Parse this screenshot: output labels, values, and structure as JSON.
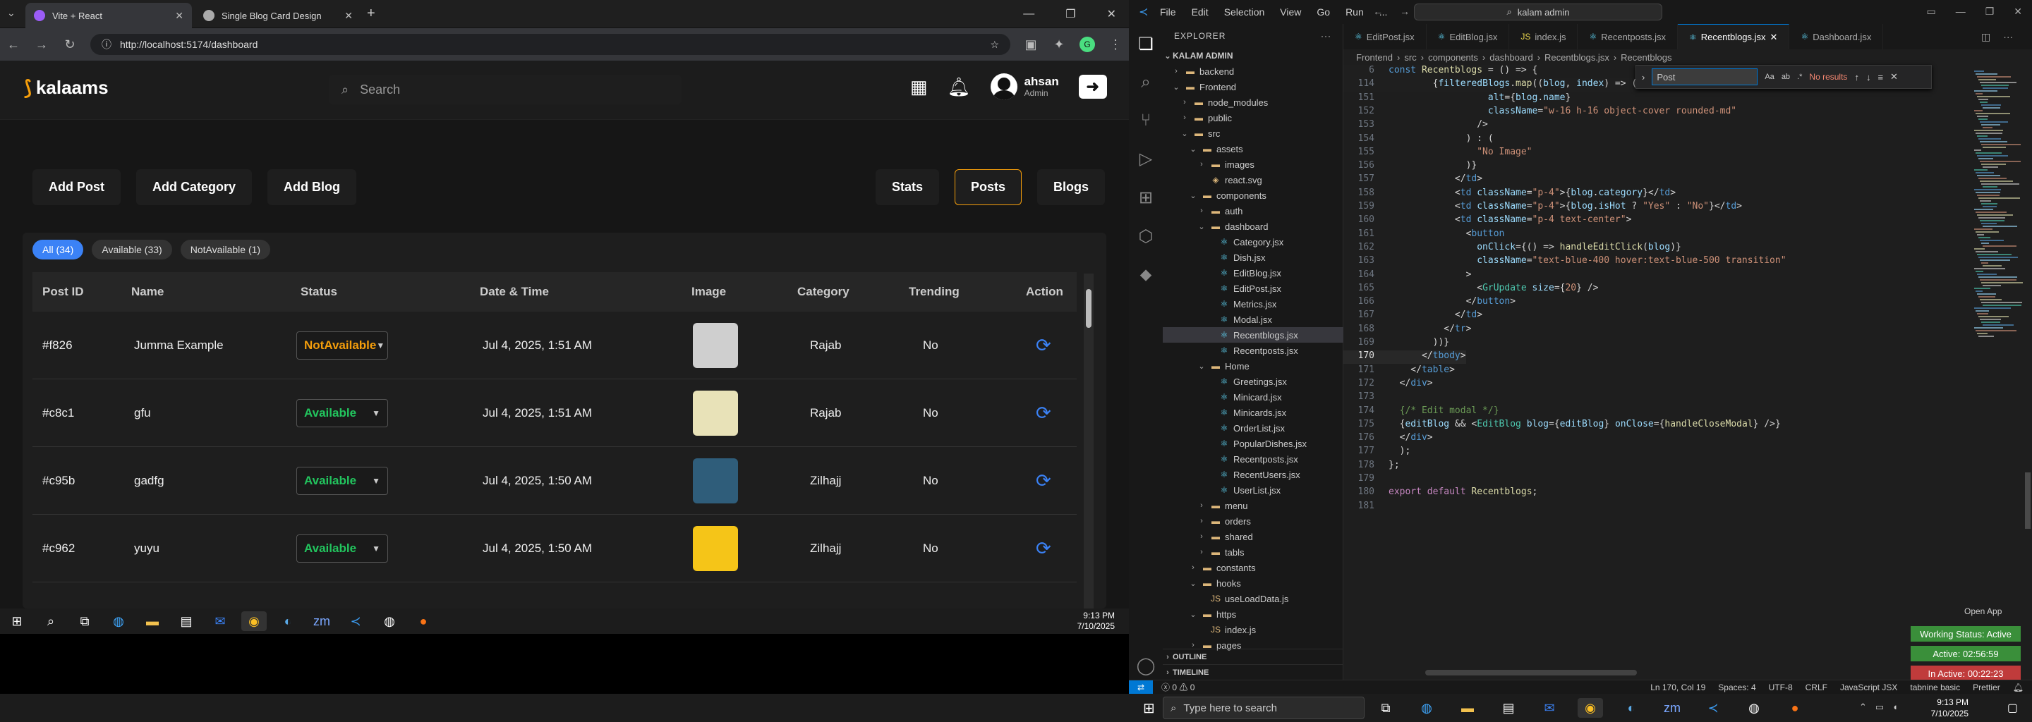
{
  "browser": {
    "tabs": [
      {
        "title": "Vite + React",
        "color": "#9b5cf6"
      },
      {
        "title": "Single Blog Card Design",
        "color": "#aaaaaa"
      }
    ],
    "url": "http://localhost:5174/dashboard"
  },
  "app": {
    "logo": "kalaams",
    "search_placeholder": "Search",
    "user_name": "ahsan",
    "user_role": "Admin",
    "actions_left": [
      "Add Post",
      "Add Category",
      "Add Blog"
    ],
    "actions_right": [
      "Stats",
      "Posts",
      "Blogs"
    ],
    "filters": [
      "All (34)",
      "Available (33)",
      "NotAvailable (1)"
    ],
    "columns": [
      "Post ID",
      "Name",
      "Status",
      "Date & Time",
      "Image",
      "Category",
      "Trending",
      "Action"
    ],
    "rows": [
      {
        "id": "#f826",
        "name": "Jumma Example",
        "status": "NotAvailable",
        "status_color": "#f59e0b",
        "date": "Jul 4, 2025, 1:51 AM",
        "thumb": "#cfcfcf",
        "category": "Rajab",
        "trending": "No"
      },
      {
        "id": "#c8c1",
        "name": "gfu",
        "status": "Available",
        "status_color": "#22c55e",
        "date": "Jul 4, 2025, 1:51 AM",
        "thumb": "#e8e2b8",
        "category": "Rajab",
        "trending": "No"
      },
      {
        "id": "#c95b",
        "name": "gadfg",
        "status": "Available",
        "status_color": "#22c55e",
        "date": "Jul 4, 2025, 1:50 AM",
        "thumb": "#2f5d7a",
        "category": "Zilhajj",
        "trending": "No"
      },
      {
        "id": "#c962",
        "name": "yuyu",
        "status": "Available",
        "status_color": "#22c55e",
        "date": "Jul 4, 2025, 1:50 AM",
        "thumb": "#f5c518",
        "category": "Zilhajj",
        "trending": "No"
      }
    ]
  },
  "taskbar_left": {
    "time": "9:13 PM",
    "date": "7/10/2025"
  },
  "vscode": {
    "menu": [
      "File",
      "Edit",
      "Selection",
      "View",
      "Go",
      "Run",
      "..."
    ],
    "search": "kalam admin",
    "explorer_title": "EXPLORER",
    "root": "KALAM ADMIN",
    "tree": [
      {
        "label": "backend",
        "indent": 1,
        "type": "folder",
        "open": false
      },
      {
        "label": "Frontend",
        "indent": 1,
        "type": "folder",
        "open": true
      },
      {
        "label": "node_modules",
        "indent": 2,
        "type": "folder",
        "open": false
      },
      {
        "label": "public",
        "indent": 2,
        "type": "folder",
        "open": false
      },
      {
        "label": "src",
        "indent": 2,
        "type": "folder",
        "open": true
      },
      {
        "label": "assets",
        "indent": 3,
        "type": "folder",
        "open": true
      },
      {
        "label": "images",
        "indent": 4,
        "type": "folder",
        "open": false
      },
      {
        "label": "react.svg",
        "indent": 4,
        "type": "file"
      },
      {
        "label": "components",
        "indent": 3,
        "type": "folder",
        "open": true
      },
      {
        "label": "auth",
        "indent": 4,
        "type": "folder",
        "open": false
      },
      {
        "label": "dashboard",
        "indent": 4,
        "type": "folder",
        "open": true
      },
      {
        "label": "Category.jsx",
        "indent": 5,
        "type": "file"
      },
      {
        "label": "Dish.jsx",
        "indent": 5,
        "type": "file"
      },
      {
        "label": "EditBlog.jsx",
        "indent": 5,
        "type": "file"
      },
      {
        "label": "EditPost.jsx",
        "indent": 5,
        "type": "file"
      },
      {
        "label": "Metrics.jsx",
        "indent": 5,
        "type": "file"
      },
      {
        "label": "Modal.jsx",
        "indent": 5,
        "type": "file"
      },
      {
        "label": "Recentblogs.jsx",
        "indent": 5,
        "type": "file",
        "selected": true
      },
      {
        "label": "Recentposts.jsx",
        "indent": 5,
        "type": "file"
      },
      {
        "label": "Home",
        "indent": 4,
        "type": "folder",
        "open": true
      },
      {
        "label": "Greetings.jsx",
        "indent": 5,
        "type": "file"
      },
      {
        "label": "Minicard.jsx",
        "indent": 5,
        "type": "file"
      },
      {
        "label": "Minicards.jsx",
        "indent": 5,
        "type": "file"
      },
      {
        "label": "OrderList.jsx",
        "indent": 5,
        "type": "file"
      },
      {
        "label": "PopularDishes.jsx",
        "indent": 5,
        "type": "file"
      },
      {
        "label": "Recentposts.jsx",
        "indent": 5,
        "type": "file"
      },
      {
        "label": "RecentUsers.jsx",
        "indent": 5,
        "type": "file"
      },
      {
        "label": "UserList.jsx",
        "indent": 5,
        "type": "file"
      },
      {
        "label": "menu",
        "indent": 4,
        "type": "folder",
        "open": false
      },
      {
        "label": "orders",
        "indent": 4,
        "type": "folder",
        "open": false
      },
      {
        "label": "shared",
        "indent": 4,
        "type": "folder",
        "open": false
      },
      {
        "label": "tabls",
        "indent": 4,
        "type": "folder",
        "open": false
      },
      {
        "label": "constants",
        "indent": 3,
        "type": "folder",
        "open": false
      },
      {
        "label": "hooks",
        "indent": 3,
        "type": "folder",
        "open": true
      },
      {
        "label": "useLoadData.js",
        "indent": 4,
        "type": "file"
      },
      {
        "label": "https",
        "indent": 3,
        "type": "folder",
        "open": true
      },
      {
        "label": "index.js",
        "indent": 4,
        "type": "file"
      },
      {
        "label": "pages",
        "indent": 3,
        "type": "folder",
        "open": false
      }
    ],
    "outline": "OUTLINE",
    "timeline": "TIMELINE",
    "tabs": [
      "EditPost.jsx",
      "EditBlog.jsx",
      "index.js",
      "Recentposts.jsx",
      "Recentblogs.jsx",
      "Dashboard.jsx"
    ],
    "active_tab": "Recentblogs.jsx",
    "breadcrumbs": [
      "Frontend",
      "src",
      "components",
      "dashboard",
      "Recentblogs.jsx",
      "Recentblogs"
    ],
    "find": {
      "query": "Post",
      "result": "No results"
    },
    "sticky": [
      {
        "n": "6",
        "html": "<span class='kw'>const</span> <span class='fn'>Recentblogs</span> = () => {"
      },
      {
        "n": "114",
        "html": "        {<span class='att'>filteredBlogs</span>.<span class='fn'>map</span>((<span class='att'>blog</span>, <span class='att'>index</span>) => ("
      }
    ],
    "code": [
      {
        "n": "151",
        "html": "                  <span class='att'>alt</span>={<span class='att'>blog</span>.<span class='att'>name</span>}"
      },
      {
        "n": "152",
        "html": "                  <span class='att'>className</span>=<span class='str'>\"w-16 h-16 object-cover rounded-md\"</span>"
      },
      {
        "n": "153",
        "html": "                /&gt;"
      },
      {
        "n": "154",
        "html": "              ) : ("
      },
      {
        "n": "155",
        "html": "                <span class='str'>\"No Image\"</span>"
      },
      {
        "n": "156",
        "html": "              )}"
      },
      {
        "n": "157",
        "html": "            &lt;/<span class='kw'>td</span>&gt;"
      },
      {
        "n": "158",
        "html": "            &lt;<span class='kw'>td</span> <span class='att'>className</span>=<span class='str'>\"p-4\"</span>&gt;{<span class='att'>blog</span>.<span class='att'>category</span>}&lt;/<span class='kw'>td</span>&gt;"
      },
      {
        "n": "159",
        "html": "            &lt;<span class='kw'>td</span> <span class='att'>className</span>=<span class='str'>\"p-4\"</span>&gt;{<span class='att'>blog</span>.<span class='att'>isHot</span> ? <span class='str'>\"Yes\"</span> : <span class='str'>\"No\"</span>}&lt;/<span class='kw'>td</span>&gt;"
      },
      {
        "n": "160",
        "html": "            &lt;<span class='kw'>td</span> <span class='att'>className</span>=<span class='str'>\"p-4 text-center\"</span>&gt;"
      },
      {
        "n": "161",
        "html": "              &lt;<span class='kw'>button</span>"
      },
      {
        "n": "162",
        "html": "                <span class='att'>onClick</span>={() => <span class='fn'>handleEditClick</span>(<span class='att'>blog</span>)}"
      },
      {
        "n": "163",
        "html": "                <span class='att'>className</span>=<span class='str'>\"text-blue-400 hover:text-blue-500 transition\"</span>"
      },
      {
        "n": "164",
        "html": "              &gt;"
      },
      {
        "n": "165",
        "html": "                &lt;<span class='tag'>GrUpdate</span> <span class='att'>size</span>={<span class='str'>20</span>} /&gt;"
      },
      {
        "n": "166",
        "html": "              &lt;/<span class='kw'>button</span>&gt;"
      },
      {
        "n": "167",
        "html": "            &lt;/<span class='kw'>td</span>&gt;"
      },
      {
        "n": "168",
        "html": "          &lt;/<span class='kw'>tr</span>&gt;"
      },
      {
        "n": "169",
        "html": "        ))}"
      },
      {
        "n": "170",
        "html": "      &lt;/<span class='kw'>tbody</span>&gt;",
        "current": true
      },
      {
        "n": "171",
        "html": "    &lt;/<span class='kw'>table</span>&gt;"
      },
      {
        "n": "172",
        "html": "  &lt;/<span class='kw'>div</span>&gt;"
      },
      {
        "n": "173",
        "html": ""
      },
      {
        "n": "174",
        "html": "  <span class='cm'>{/* Edit modal */}</span>"
      },
      {
        "n": "175",
        "html": "  {<span class='att'>editBlog</span> &amp;&amp; &lt;<span class='tag'>EditBlog</span> <span class='att'>blog</span>={<span class='att'>editBlog</span>} <span class='att'>onClose</span>={<span class='fn'>handleCloseModal</span>} /&gt;}"
      },
      {
        "n": "176",
        "html": "  &lt;/<span class='kw'>div</span>&gt;"
      },
      {
        "n": "177",
        "html": "  );"
      },
      {
        "n": "178",
        "html": "};"
      },
      {
        "n": "179",
        "html": ""
      },
      {
        "n": "180",
        "html": "<span class='pur'>export</span> <span class='pur'>default</span> <span class='fn'>Recentblogs</span>;"
      },
      {
        "n": "181",
        "html": ""
      }
    ],
    "status": {
      "errors": "0",
      "warnings": "0",
      "position": "Ln 170, Col 19",
      "spaces": "Spaces: 4",
      "encoding": "UTF-8",
      "eol": "CRLF",
      "language": "JavaScript JSX",
      "tabnine": "tabnine basic",
      "prettier": "Prettier"
    },
    "open_app": "Open App",
    "working_status": "Working Status: Active",
    "active_time": "Active: 02:56:59",
    "inactive_time": "In Active: 00:22:23"
  },
  "taskbar": {
    "search_placeholder": "Type here to search",
    "time": "9:13 PM",
    "date": "7/10/2025"
  }
}
